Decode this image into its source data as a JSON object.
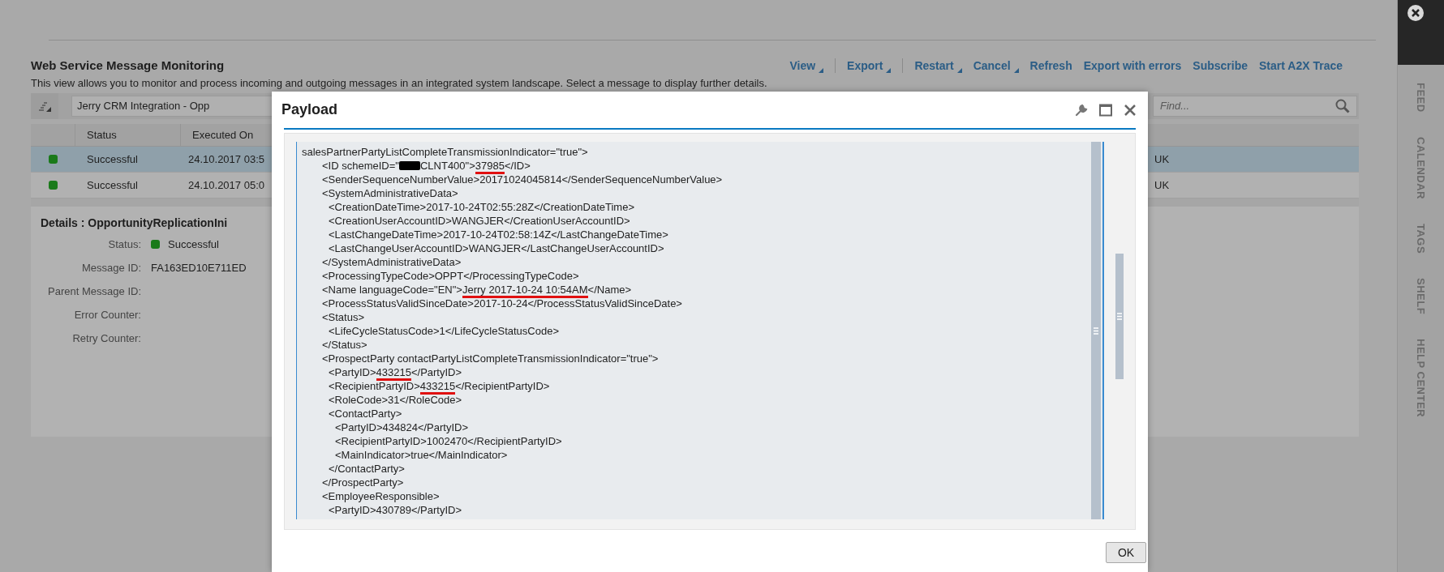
{
  "page": {
    "title": "Web Service Message Monitoring",
    "description": "This view allows you to monitor and process incoming and outgoing messages in an integrated system landscape. Select a message to display further details."
  },
  "toolbar": [
    {
      "label": "View",
      "menu": true,
      "separator_after": true
    },
    {
      "label": "Export",
      "menu": true,
      "separator_after": true
    },
    {
      "label": "Restart",
      "menu": true,
      "separator_after": false
    },
    {
      "label": "Cancel",
      "menu": true,
      "separator_after": false
    },
    {
      "label": "Refresh",
      "menu": false,
      "separator_after": false
    },
    {
      "label": "Export with errors",
      "menu": false,
      "separator_after": false
    },
    {
      "label": "Subscribe",
      "menu": false,
      "separator_after": false
    },
    {
      "label": "Start A2X Trace",
      "menu": false,
      "separator_after": false
    }
  ],
  "filter": {
    "value": "Jerry CRM Integration - Opp"
  },
  "search": {
    "placeholder": "Find..."
  },
  "table": {
    "columns": [
      "Status",
      "Executed On"
    ],
    "rows": [
      {
        "selected": true,
        "color": "#1a7a1a",
        "status": "Successful",
        "executed_on": "24.10.2017 03:5",
        "column_right": "UK"
      },
      {
        "selected": false,
        "color": "#1a7a1a",
        "status": "Successful",
        "executed_on": "24.10.2017 05:0",
        "column_right": "UK"
      }
    ]
  },
  "details": {
    "title": "Details : OpportunityReplicationIni",
    "fields": [
      {
        "label": "Status:",
        "value": "Successful",
        "color": "#1a7a1a"
      },
      {
        "label": "Message ID:",
        "value": "FA163ED10E711ED"
      },
      {
        "label": "Parent Message ID:"
      },
      {
        "label": "Error Counter:"
      },
      {
        "label": "Retry Counter:"
      }
    ]
  },
  "side_panel": [
    "FEED",
    "CALENDAR",
    "TAGS",
    "SHELF",
    "HELP CENTER"
  ],
  "dialog": {
    "title": "Payload",
    "ok": "OK",
    "xml": [
      {
        "open": [
          {
            "kind": "plain",
            "text": "salesPartnerPartyListCompleteTransmissionIndicator=\"true\">"
          }
        ],
        "children": [
          {
            "line": [
              {
                "kind": "plain",
                "text": "<ID schemeID=\""
              },
              {
                "kind": "redacted"
              },
              {
                "kind": "plain",
                "text": "CLNT400\">"
              },
              {
                "kind": "underlined",
                "text": "37985"
              },
              {
                "kind": "plain",
                "text": "</ID>"
              }
            ]
          },
          {
            "line": [
              {
                "kind": "plain",
                "text": "<SenderSequenceNumberValue>20171024045814</SenderSequenceNumberValue>"
              }
            ]
          },
          {
            "open": [
              {
                "kind": "plain",
                "text": "<SystemAdministrativeData>"
              }
            ],
            "children": [
              {
                "line": [
                  {
                    "kind": "plain",
                    "text": "<CreationDateTime>2017-10-24T02:55:28Z</CreationDateTime>"
                  }
                ]
              },
              {
                "line": [
                  {
                    "kind": "plain",
                    "text": "<CreationUserAccountID>WANGJER</CreationUserAccountID>"
                  }
                ]
              },
              {
                "line": [
                  {
                    "kind": "plain",
                    "text": "<LastChangeDateTime>2017-10-24T02:58:14Z</LastChangeDateTime>"
                  }
                ]
              },
              {
                "line": [
                  {
                    "kind": "plain",
                    "text": "<LastChangeUserAccountID>WANGJER</LastChangeUserAccountID>"
                  }
                ]
              }
            ],
            "close": [
              {
                "kind": "plain",
                "text": "</SystemAdministrativeData>"
              }
            ]
          },
          {
            "line": [
              {
                "kind": "plain",
                "text": "<ProcessingTypeCode>OPPT</ProcessingTypeCode>"
              }
            ]
          },
          {
            "line": [
              {
                "kind": "plain",
                "text": "<Name languageCode=\"EN\">"
              },
              {
                "kind": "underlined",
                "text": "Jerry 2017-10-24 10:54AM"
              },
              {
                "kind": "plain",
                "text": "</Name>"
              }
            ]
          },
          {
            "line": [
              {
                "kind": "plain",
                "text": "<ProcessStatusValidSinceDate>2017-10-24</ProcessStatusValidSinceDate>"
              }
            ]
          },
          {
            "open": [
              {
                "kind": "plain",
                "text": "<Status>"
              }
            ],
            "children": [
              {
                "line": [
                  {
                    "kind": "plain",
                    "text": "<LifeCycleStatusCode>1</LifeCycleStatusCode>"
                  }
                ]
              }
            ],
            "close": [
              {
                "kind": "plain",
                "text": "</Status>"
              }
            ]
          },
          {
            "open": [
              {
                "kind": "plain",
                "text": "<ProspectParty contactPartyListCompleteTransmissionIndicator=\"true\">"
              }
            ],
            "children": [
              {
                "line": [
                  {
                    "kind": "plain",
                    "text": "<PartyID>"
                  },
                  {
                    "kind": "underlined",
                    "text": "433215"
                  },
                  {
                    "kind": "plain",
                    "text": "</PartyID>"
                  }
                ]
              },
              {
                "line": [
                  {
                    "kind": "plain",
                    "text": "<RecipientPartyID>"
                  },
                  {
                    "kind": "underlined",
                    "text": "433215"
                  },
                  {
                    "kind": "plain",
                    "text": "</RecipientPartyID>"
                  }
                ]
              },
              {
                "line": [
                  {
                    "kind": "plain",
                    "text": "<RoleCode>31</RoleCode>"
                  }
                ]
              },
              {
                "open": [
                  {
                    "kind": "plain",
                    "text": "<ContactParty>"
                  }
                ],
                "children": [
                  {
                    "line": [
                      {
                        "kind": "plain",
                        "text": "<PartyID>434824</PartyID>"
                      }
                    ]
                  },
                  {
                    "line": [
                      {
                        "kind": "plain",
                        "text": "<RecipientPartyID>1002470</RecipientPartyID>"
                      }
                    ]
                  },
                  {
                    "line": [
                      {
                        "kind": "plain",
                        "text": "<MainIndicator>true</MainIndicator>"
                      }
                    ]
                  }
                ],
                "close": [
                  {
                    "kind": "plain",
                    "text": "</ContactParty>"
                  }
                ]
              }
            ],
            "close": [
              {
                "kind": "plain",
                "text": "</ProspectParty>"
              }
            ]
          },
          {
            "open": [
              {
                "kind": "plain",
                "text": "<EmployeeResponsible>"
              }
            ],
            "children": [
              {
                "line": [
                  {
                    "kind": "plain",
                    "text": "<PartyID>430789</PartyID>"
                  }
                ]
              }
            ]
          }
        ]
      }
    ]
  }
}
